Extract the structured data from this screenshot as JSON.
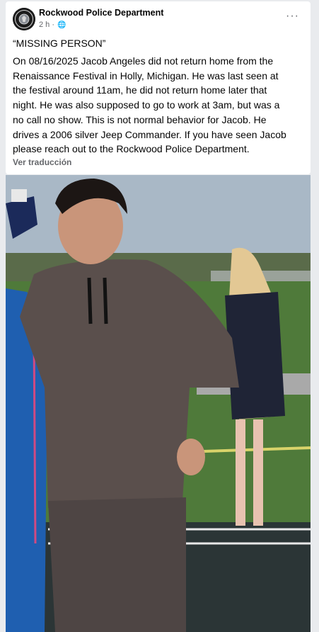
{
  "post": {
    "author": "Rockwood Police Department",
    "avatar_text": "ROCKWOOD POLICE",
    "time": "2 h",
    "privacy_icon": "globe-icon",
    "more_icon": "more-options-icon",
    "title": "“MISSING PERSON”",
    "body_lines": [
      "On 08/16/2025 Jacob Angeles did not return home from the",
      "Renaissance Festival in Holly, Michigan. He was last seen at",
      "the festival around 11am, he did not return home later that",
      "night.  He was also supposed to go to work at 3am, but was a",
      "no call no show. This is not normal behavior for Jacob. He",
      "drives a 2006 silver Jeep Commander.  If you have seen Jacob",
      "please reach out to the Rockwood Police Department."
    ],
    "translate_label": "Ver traducción"
  },
  "colors": {
    "page_bg": "#e9ebee",
    "text_primary": "#050505",
    "text_secondary": "#65676b"
  }
}
